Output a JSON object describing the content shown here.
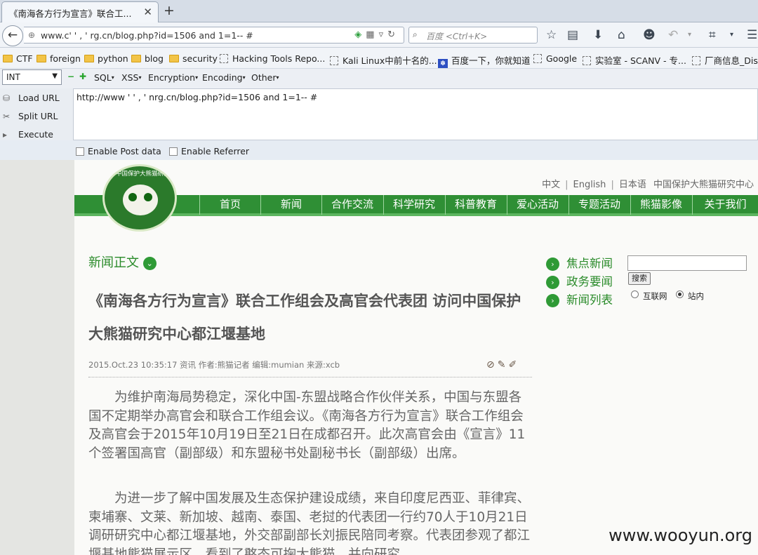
{
  "browser": {
    "tab_title": "《南海各方行为宣言》联合工...",
    "tab_close": "✕",
    "new_tab": "+",
    "url": "www.c'  '    ,      '  rg.cn/blog.php?id=1506 and 1=1-- #",
    "search_placeholder": "百度 <Ctrl+K>"
  },
  "bookmarks": [
    {
      "label": "CTF",
      "type": "folder"
    },
    {
      "label": "foreign",
      "type": "folder"
    },
    {
      "label": "python",
      "type": "folder"
    },
    {
      "label": "blog",
      "type": "folder"
    },
    {
      "label": "security",
      "type": "folder"
    },
    {
      "label": "Hacking Tools Repo...",
      "type": "page"
    },
    {
      "label": "Kali Linux中前十名的...",
      "type": "page"
    },
    {
      "label": "百度一下，你就知道",
      "type": "baidu"
    },
    {
      "label": "Google",
      "type": "page"
    },
    {
      "label": "实验室 - SCANV - 专...",
      "type": "page"
    },
    {
      "label": "厂商信息_Disc",
      "type": "page"
    }
  ],
  "hackbar": {
    "select_value": "INT",
    "menus": [
      "SQL",
      "XSS",
      "Encryption",
      "Encoding",
      "Other"
    ],
    "load_url": "Load URL",
    "split_url": "Split URL",
    "execute": "Execute",
    "url_value": "http://www  '  '    ,     '   nrg.cn/blog.php?id=1506 and 1=1-- #",
    "post_data": "Enable Post data",
    "referrer": "Enable Referrer"
  },
  "site": {
    "logo_text": "中国保护大熊猫研究中心",
    "languages": [
      "中文",
      "English",
      "日本语"
    ],
    "org_name": "中国保护大熊猫研究中心",
    "nav": [
      "首页",
      "新闻",
      "合作交流",
      "科学研究",
      "科普教育",
      "爱心活动",
      "专题活动",
      "熊猫影像",
      "关于我们"
    ],
    "section_title": "新闻正文",
    "headline": "《南海各方行为宣言》联合工作组会及高官会代表团 访问中国保护大熊猫研究中心都江堰基地",
    "meta": "2015.Oct.23 10:35:17 资讯 作者:熊猫记者 编辑:mumian 来源:xcb",
    "paragraph1": "为维护南海局势稳定，深化中国-东盟战略合作伙伴关系，中国与东盟各国不定期举办高官会和联合工作组会议。《南海各方行为宣言》联合工作组会及高官会于2015年10月19日至21日在成都召开。此次高官会由《宣言》11个签署国高官（副部级）和东盟秘书处副秘书长（副部级）出席。",
    "paragraph2": "为进一步了解中国发展及生态保护建设成绩，来自印度尼西亚、菲律宾、柬埔寨、文莱、新加坡、越南、泰国、老挝的代表团一行约70人于10月21日调研研究中心都江堰基地，外交部副部长刘振民陪同考察。代表团参观了都江堰基地熊猫展示区，看到了憨态可掬大熊猫，并向研究",
    "side_links": [
      "焦点新闻",
      "政务要闻",
      "新闻列表"
    ],
    "search_button": "搜索",
    "radio1": "互联网",
    "radio2": "站内"
  },
  "watermark": "www.wooyun.org"
}
